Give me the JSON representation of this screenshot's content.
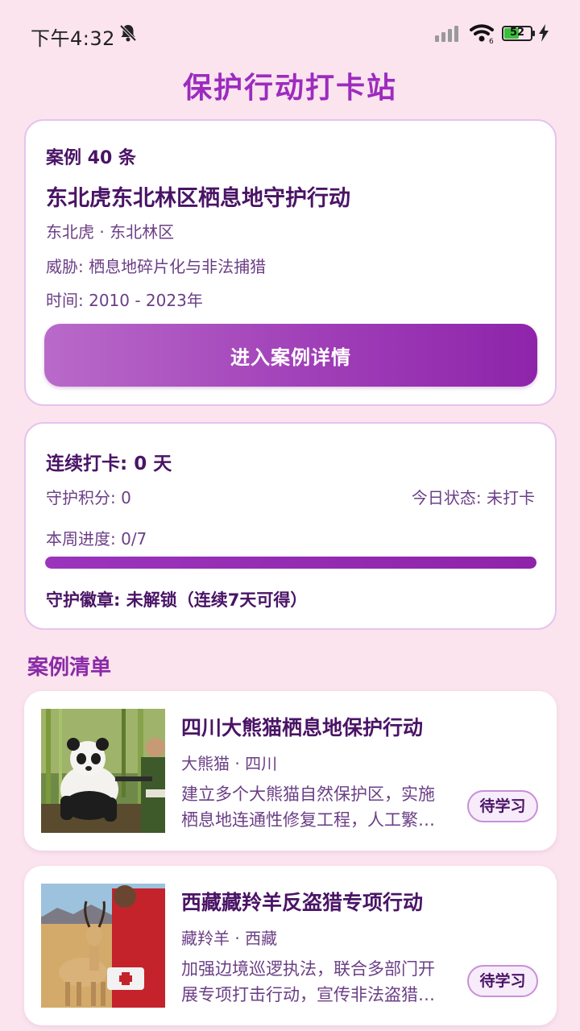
{
  "status_bar": {
    "time": "下午4:32",
    "battery_level": "52",
    "battery_fraction": 0.52
  },
  "app": {
    "title": "保护行动打卡站"
  },
  "featured": {
    "count_label": "案例 40 条",
    "title": "东北虎东北林区栖息地守护行动",
    "species_region": "东北虎 · 东北林区",
    "threat": "威胁: 栖息地碎片化与非法捕猎",
    "period": "时间: 2010 - 2023年",
    "button_label": "进入案例详情"
  },
  "checkin": {
    "streak": "连续打卡: 0 天",
    "points": "守护积分: 0",
    "today_status": "今日状态: 未打卡",
    "week_progress": "本周进度: 0/7",
    "progress_value": 0,
    "badge": "守护徽章: 未解锁（连续7天可得）"
  },
  "case_list": {
    "title": "案例清单",
    "items": [
      {
        "title": "四川大熊猫栖息地保护行动",
        "meta": "大熊猫 · 四川",
        "desc_line1": "建立多个大熊猫自然保护区，实施",
        "desc_line2": "栖息地连通性修复工程，人工繁…",
        "badge": "待学习"
      },
      {
        "title": "西藏藏羚羊反盗猎专项行动",
        "meta": "藏羚羊 · 西藏",
        "desc_line1": "加强边境巡逻执法，联合多部门开",
        "desc_line2": "展专项打击行动，宣传非法盗猎…",
        "badge": "待学习"
      }
    ]
  },
  "colors": {
    "background": "#fbe4ee",
    "accent": "#9c2bbf",
    "text_primary": "#4a1466",
    "text_secondary": "#6b3f86"
  },
  "icons": [
    "bell-off-icon",
    "signal-icon",
    "wifi-icon",
    "battery-icon",
    "charging-icon"
  ]
}
